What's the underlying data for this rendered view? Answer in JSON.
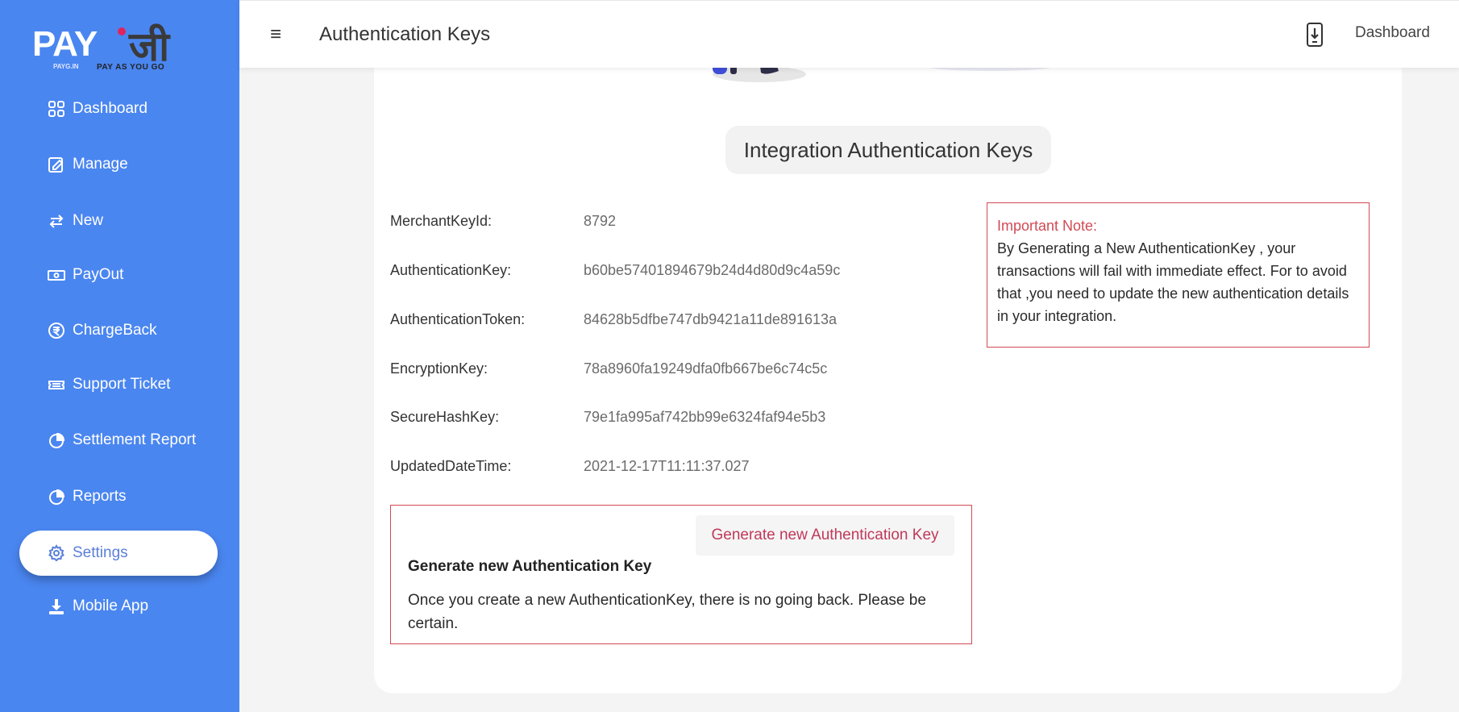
{
  "logo": {
    "brand": "PAY",
    "brand_suffix": "जी",
    "sub": "PAYG.IN",
    "tagline": "PAY AS YOU GO"
  },
  "sidebar": {
    "items": [
      {
        "label": "Dashboard",
        "icon": "grid-icon"
      },
      {
        "label": "Manage",
        "icon": "edit-icon"
      },
      {
        "label": "New",
        "icon": "swap-arrows-icon"
      },
      {
        "label": "PayOut",
        "icon": "money-icon"
      },
      {
        "label": "ChargeBack",
        "icon": "rupee-circle-icon"
      },
      {
        "label": "Support Ticket",
        "icon": "ticket-icon"
      },
      {
        "label": "Settlement Report",
        "icon": "pie-chart-icon"
      },
      {
        "label": "Reports",
        "icon": "pie-chart-icon"
      },
      {
        "label": "Settings",
        "icon": "gear-icon",
        "active": true
      },
      {
        "label": "Mobile App",
        "icon": "download-icon"
      }
    ]
  },
  "header": {
    "title": "Authentication Keys",
    "link": "Dashboard"
  },
  "main": {
    "section_title": "Integration Authentication Keys",
    "fields": [
      {
        "label": "MerchantKeyId:",
        "value": "8792"
      },
      {
        "label": "AuthenticationKey:",
        "value": "b60be57401894679b24d4d80d9c4a59c"
      },
      {
        "label": "AuthenticationToken:",
        "value": "84628b5dfbe747db9421a11de891613a"
      },
      {
        "label": "EncryptionKey:",
        "value": "78a8960fa19249dfa0fb667be6c74c5c"
      },
      {
        "label": "SecureHashKey:",
        "value": "79e1fa995af742bb99e6324faf94e5b3"
      },
      {
        "label": "UpdatedDateTime:",
        "value": "2021-12-17T11:11:37.027"
      }
    ],
    "note": {
      "title": "Important Note:",
      "text": "By Generating a New AuthenticationKey , your transactions will fail with immediate effect. For to avoid that ,you need to update the new authentication details in your integration."
    },
    "generate": {
      "button": "Generate new Authentication Key",
      "heading": "Generate new Authentication Key",
      "description": "Once you create a new AuthenticationKey, there is no going back. Please be certain."
    }
  },
  "colors": {
    "sidebar": "#4a86f0",
    "accent_red": "#d24a55",
    "button_text": "#c0395a"
  }
}
